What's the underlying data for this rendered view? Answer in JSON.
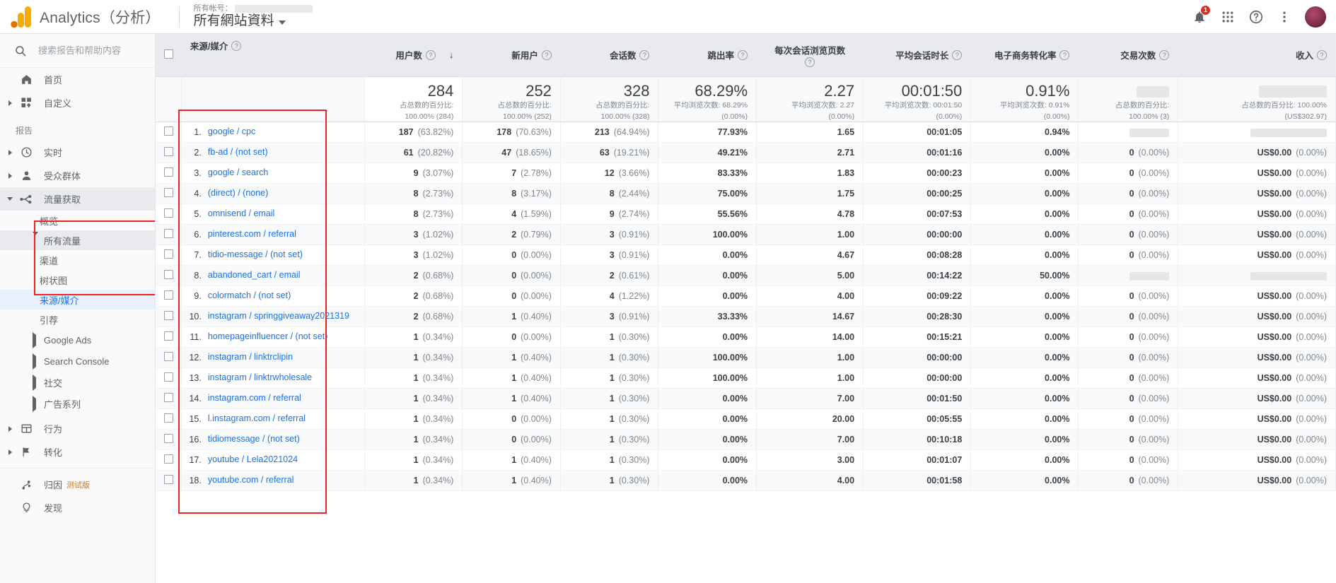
{
  "topbar": {
    "brand": "Analytics（分析）",
    "account_label": "所有帐号：",
    "property_name": "所有網站資料",
    "notification_count": "1",
    "icons": {
      "bell": "notifications-icon",
      "apps": "apps-grid-icon",
      "help": "help-icon",
      "more": "more-vertical-icon",
      "avatar": "user-avatar"
    }
  },
  "sidebar": {
    "search_placeholder": "搜索报告和帮助内容",
    "search_value": "",
    "items": [
      {
        "label": "首页",
        "icon": "home-icon",
        "expandable": false
      },
      {
        "label": "自定义",
        "icon": "customization-icon",
        "expandable": true
      }
    ],
    "section_label": "报告",
    "reports": [
      {
        "label": "实时",
        "icon": "realtime-clock-icon",
        "expandable": true,
        "active": false
      },
      {
        "label": "受众群体",
        "icon": "audience-person-icon",
        "expandable": true,
        "active": false
      },
      {
        "label": "流量获取",
        "icon": "acquisition-icon",
        "expandable": true,
        "active": true
      }
    ],
    "acquisition_children": [
      {
        "label": "概览",
        "type": "leaf"
      },
      {
        "label": "所有流量",
        "type": "group-open"
      },
      {
        "label": "渠道",
        "type": "child"
      },
      {
        "label": "树状图",
        "type": "child"
      },
      {
        "label": "来源/媒介",
        "type": "child-selected"
      },
      {
        "label": "引荐",
        "type": "child"
      },
      {
        "label": "Google Ads",
        "type": "group"
      },
      {
        "label": "Search Console",
        "type": "group"
      },
      {
        "label": "社交",
        "type": "group"
      },
      {
        "label": "广告系列",
        "type": "group"
      }
    ],
    "bottom_items": [
      {
        "label": "行为",
        "icon": "behavior-icon",
        "expandable": true,
        "tag": ""
      },
      {
        "label": "转化",
        "icon": "conversions-flag-icon",
        "expandable": true,
        "tag": ""
      },
      {
        "label": "归因",
        "icon": "attribution-icon",
        "expandable": false,
        "tag": "测试版"
      },
      {
        "label": "发现",
        "icon": "discover-bulb-icon",
        "expandable": false,
        "tag": ""
      }
    ],
    "highlight_color": "#f32121"
  },
  "table": {
    "columns": [
      {
        "key": "dim",
        "label": "来源/媒介",
        "align": "left",
        "sorted": false
      },
      {
        "key": "users",
        "label": "用户数",
        "align": "right",
        "sorted": true
      },
      {
        "key": "new_users",
        "label": "新用户",
        "align": "right",
        "sorted": false
      },
      {
        "key": "sessions",
        "label": "会话数",
        "align": "right",
        "sorted": false
      },
      {
        "key": "bounce",
        "label": "跳出率",
        "align": "right",
        "sorted": false
      },
      {
        "key": "pages",
        "label": "每次会话浏览页数",
        "align": "right",
        "sorted": false
      },
      {
        "key": "duration",
        "label": "平均会话时长",
        "align": "right",
        "sorted": false
      },
      {
        "key": "ecomm",
        "label": "电子商务转化率",
        "align": "right",
        "sorted": false
      },
      {
        "key": "trans",
        "label": "交易次数",
        "align": "right",
        "sorted": false
      },
      {
        "key": "revenue",
        "label": "收入",
        "align": "right",
        "sorted": false
      }
    ],
    "sort_indicator": "↓",
    "summary": [
      {
        "value": "284",
        "sub1": "占总数的百分比:",
        "sub2": "100.00% (284)",
        "redacted": false
      },
      {
        "value": "252",
        "sub1": "占总数的百分比:",
        "sub2": "100.00% (252)",
        "redacted": false
      },
      {
        "value": "328",
        "sub1": "占总数的百分比:",
        "sub2": "100.00% (328)",
        "redacted": false
      },
      {
        "value": "68.29%",
        "sub1": "平均浏览次数: 68.29%",
        "sub2": "(0.00%)",
        "redacted": false
      },
      {
        "value": "2.27",
        "sub1": "平均浏览次数: 2.27",
        "sub2": "(0.00%)",
        "redacted": false
      },
      {
        "value": "00:01:50",
        "sub1": "平均浏览次数: 00:01:50",
        "sub2": "(0.00%)",
        "redacted": false
      },
      {
        "value": "0.91%",
        "sub1": "平均浏览次数: 0.91%",
        "sub2": "(0.00%)",
        "redacted": false
      },
      {
        "value": "",
        "sub1": "占总数的百分比:",
        "sub2": "100.00% (3)",
        "redacted": true
      },
      {
        "value": "",
        "sub1": "占总数的百分比: 100.00%",
        "sub2": "(US$302.97)",
        "redacted": true
      }
    ],
    "rows": [
      {
        "n": "1.",
        "dim": "google / cpc",
        "users": "187",
        "users_pct": "(63.82%)",
        "new_users": "178",
        "new_users_pct": "(70.63%)",
        "sessions": "213",
        "sessions_pct": "(64.94%)",
        "bounce": "77.93%",
        "pages": "1.65",
        "duration": "00:01:05",
        "ecomm": "0.94%",
        "trans": "2",
        "trans_pct": "(66.67%)",
        "revenue": "",
        "revenue_pct": "",
        "trans_blur": true,
        "revenue_blur": true
      },
      {
        "n": "2.",
        "dim": "fb-ad / (not set)",
        "users": "61",
        "users_pct": "(20.82%)",
        "new_users": "47",
        "new_users_pct": "(18.65%)",
        "sessions": "63",
        "sessions_pct": "(19.21%)",
        "bounce": "49.21%",
        "pages": "2.71",
        "duration": "00:01:16",
        "ecomm": "0.00%",
        "trans": "0",
        "trans_pct": "(0.00%)",
        "revenue": "US$0.00",
        "revenue_pct": "(0.00%)",
        "trans_blur": false,
        "revenue_blur": false
      },
      {
        "n": "3.",
        "dim": "google / search",
        "users": "9",
        "users_pct": "(3.07%)",
        "new_users": "7",
        "new_users_pct": "(2.78%)",
        "sessions": "12",
        "sessions_pct": "(3.66%)",
        "bounce": "83.33%",
        "pages": "1.83",
        "duration": "00:00:23",
        "ecomm": "0.00%",
        "trans": "0",
        "trans_pct": "(0.00%)",
        "revenue": "US$0.00",
        "revenue_pct": "(0.00%)",
        "trans_blur": false,
        "revenue_blur": false
      },
      {
        "n": "4.",
        "dim": "(direct) / (none)",
        "users": "8",
        "users_pct": "(2.73%)",
        "new_users": "8",
        "new_users_pct": "(3.17%)",
        "sessions": "8",
        "sessions_pct": "(2.44%)",
        "bounce": "75.00%",
        "pages": "1.75",
        "duration": "00:00:25",
        "ecomm": "0.00%",
        "trans": "0",
        "trans_pct": "(0.00%)",
        "revenue": "US$0.00",
        "revenue_pct": "(0.00%)",
        "trans_blur": false,
        "revenue_blur": false
      },
      {
        "n": "5.",
        "dim": "omnisend / email",
        "users": "8",
        "users_pct": "(2.73%)",
        "new_users": "4",
        "new_users_pct": "(1.59%)",
        "sessions": "9",
        "sessions_pct": "(2.74%)",
        "bounce": "55.56%",
        "pages": "4.78",
        "duration": "00:07:53",
        "ecomm": "0.00%",
        "trans": "0",
        "trans_pct": "(0.00%)",
        "revenue": "US$0.00",
        "revenue_pct": "(0.00%)",
        "trans_blur": false,
        "revenue_blur": false
      },
      {
        "n": "6.",
        "dim": "pinterest.com / referral",
        "users": "3",
        "users_pct": "(1.02%)",
        "new_users": "2",
        "new_users_pct": "(0.79%)",
        "sessions": "3",
        "sessions_pct": "(0.91%)",
        "bounce": "100.00%",
        "pages": "1.00",
        "duration": "00:00:00",
        "ecomm": "0.00%",
        "trans": "0",
        "trans_pct": "(0.00%)",
        "revenue": "US$0.00",
        "revenue_pct": "(0.00%)",
        "trans_blur": false,
        "revenue_blur": false
      },
      {
        "n": "7.",
        "dim": "tidio-message / (not set)",
        "users": "3",
        "users_pct": "(1.02%)",
        "new_users": "0",
        "new_users_pct": "(0.00%)",
        "sessions": "3",
        "sessions_pct": "(0.91%)",
        "bounce": "0.00%",
        "pages": "4.67",
        "duration": "00:08:28",
        "ecomm": "0.00%",
        "trans": "0",
        "trans_pct": "(0.00%)",
        "revenue": "US$0.00",
        "revenue_pct": "(0.00%)",
        "trans_blur": false,
        "revenue_blur": false
      },
      {
        "n": "8.",
        "dim": "abandoned_cart / email",
        "users": "2",
        "users_pct": "(0.68%)",
        "new_users": "0",
        "new_users_pct": "(0.00%)",
        "sessions": "2",
        "sessions_pct": "(0.61%)",
        "bounce": "0.00%",
        "pages": "5.00",
        "duration": "00:14:22",
        "ecomm": "50.00%",
        "trans": "1",
        "trans_pct": "(33.33%)",
        "revenue": "US$",
        "revenue_pct": "",
        "trans_blur": true,
        "revenue_blur": true
      },
      {
        "n": "9.",
        "dim": "colormatch / (not set)",
        "users": "2",
        "users_pct": "(0.68%)",
        "new_users": "0",
        "new_users_pct": "(0.00%)",
        "sessions": "4",
        "sessions_pct": "(1.22%)",
        "bounce": "0.00%",
        "pages": "4.00",
        "duration": "00:09:22",
        "ecomm": "0.00%",
        "trans": "0",
        "trans_pct": "(0.00%)",
        "revenue": "US$0.00",
        "revenue_pct": "(0.00%)",
        "trans_blur": false,
        "revenue_blur": false
      },
      {
        "n": "10.",
        "dim": "instagram / springgiveaway2021319",
        "users": "2",
        "users_pct": "(0.68%)",
        "new_users": "1",
        "new_users_pct": "(0.40%)",
        "sessions": "3",
        "sessions_pct": "(0.91%)",
        "bounce": "33.33%",
        "pages": "14.67",
        "duration": "00:28:30",
        "ecomm": "0.00%",
        "trans": "0",
        "trans_pct": "(0.00%)",
        "revenue": "US$0.00",
        "revenue_pct": "(0.00%)",
        "trans_blur": false,
        "revenue_blur": false
      },
      {
        "n": "11.",
        "dim": "homepageinfluencer / (not set)",
        "users": "1",
        "users_pct": "(0.34%)",
        "new_users": "0",
        "new_users_pct": "(0.00%)",
        "sessions": "1",
        "sessions_pct": "(0.30%)",
        "bounce": "0.00%",
        "pages": "14.00",
        "duration": "00:15:21",
        "ecomm": "0.00%",
        "trans": "0",
        "trans_pct": "(0.00%)",
        "revenue": "US$0.00",
        "revenue_pct": "(0.00%)",
        "trans_blur": false,
        "revenue_blur": false
      },
      {
        "n": "12.",
        "dim": "instagram / linktrclipin",
        "users": "1",
        "users_pct": "(0.34%)",
        "new_users": "1",
        "new_users_pct": "(0.40%)",
        "sessions": "1",
        "sessions_pct": "(0.30%)",
        "bounce": "100.00%",
        "pages": "1.00",
        "duration": "00:00:00",
        "ecomm": "0.00%",
        "trans": "0",
        "trans_pct": "(0.00%)",
        "revenue": "US$0.00",
        "revenue_pct": "(0.00%)",
        "trans_blur": false,
        "revenue_blur": false
      },
      {
        "n": "13.",
        "dim": "instagram / linktrwholesale",
        "users": "1",
        "users_pct": "(0.34%)",
        "new_users": "1",
        "new_users_pct": "(0.40%)",
        "sessions": "1",
        "sessions_pct": "(0.30%)",
        "bounce": "100.00%",
        "pages": "1.00",
        "duration": "00:00:00",
        "ecomm": "0.00%",
        "trans": "0",
        "trans_pct": "(0.00%)",
        "revenue": "US$0.00",
        "revenue_pct": "(0.00%)",
        "trans_blur": false,
        "revenue_blur": false
      },
      {
        "n": "14.",
        "dim": "instagram.com / referral",
        "users": "1",
        "users_pct": "(0.34%)",
        "new_users": "1",
        "new_users_pct": "(0.40%)",
        "sessions": "1",
        "sessions_pct": "(0.30%)",
        "bounce": "0.00%",
        "pages": "7.00",
        "duration": "00:01:50",
        "ecomm": "0.00%",
        "trans": "0",
        "trans_pct": "(0.00%)",
        "revenue": "US$0.00",
        "revenue_pct": "(0.00%)",
        "trans_blur": false,
        "revenue_blur": false
      },
      {
        "n": "15.",
        "dim": "l.instagram.com / referral",
        "users": "1",
        "users_pct": "(0.34%)",
        "new_users": "0",
        "new_users_pct": "(0.00%)",
        "sessions": "1",
        "sessions_pct": "(0.30%)",
        "bounce": "0.00%",
        "pages": "20.00",
        "duration": "00:05:55",
        "ecomm": "0.00%",
        "trans": "0",
        "trans_pct": "(0.00%)",
        "revenue": "US$0.00",
        "revenue_pct": "(0.00%)",
        "trans_blur": false,
        "revenue_blur": false
      },
      {
        "n": "16.",
        "dim": "tidiomessage / (not set)",
        "users": "1",
        "users_pct": "(0.34%)",
        "new_users": "0",
        "new_users_pct": "(0.00%)",
        "sessions": "1",
        "sessions_pct": "(0.30%)",
        "bounce": "0.00%",
        "pages": "7.00",
        "duration": "00:10:18",
        "ecomm": "0.00%",
        "trans": "0",
        "trans_pct": "(0.00%)",
        "revenue": "US$0.00",
        "revenue_pct": "(0.00%)",
        "trans_blur": false,
        "revenue_blur": false
      },
      {
        "n": "17.",
        "dim": "youtube / Lela2021024",
        "users": "1",
        "users_pct": "(0.34%)",
        "new_users": "1",
        "new_users_pct": "(0.40%)",
        "sessions": "1",
        "sessions_pct": "(0.30%)",
        "bounce": "0.00%",
        "pages": "3.00",
        "duration": "00:01:07",
        "ecomm": "0.00%",
        "trans": "0",
        "trans_pct": "(0.00%)",
        "revenue": "US$0.00",
        "revenue_pct": "(0.00%)",
        "trans_blur": false,
        "revenue_blur": false
      },
      {
        "n": "18.",
        "dim": "youtube.com / referral",
        "users": "1",
        "users_pct": "(0.34%)",
        "new_users": "1",
        "new_users_pct": "(0.40%)",
        "sessions": "1",
        "sessions_pct": "(0.30%)",
        "bounce": "0.00%",
        "pages": "4.00",
        "duration": "00:01:58",
        "ecomm": "0.00%",
        "trans": "0",
        "trans_pct": "(0.00%)",
        "revenue": "US$0.00",
        "revenue_pct": "(0.00%)",
        "trans_blur": false,
        "revenue_blur": false
      }
    ]
  }
}
